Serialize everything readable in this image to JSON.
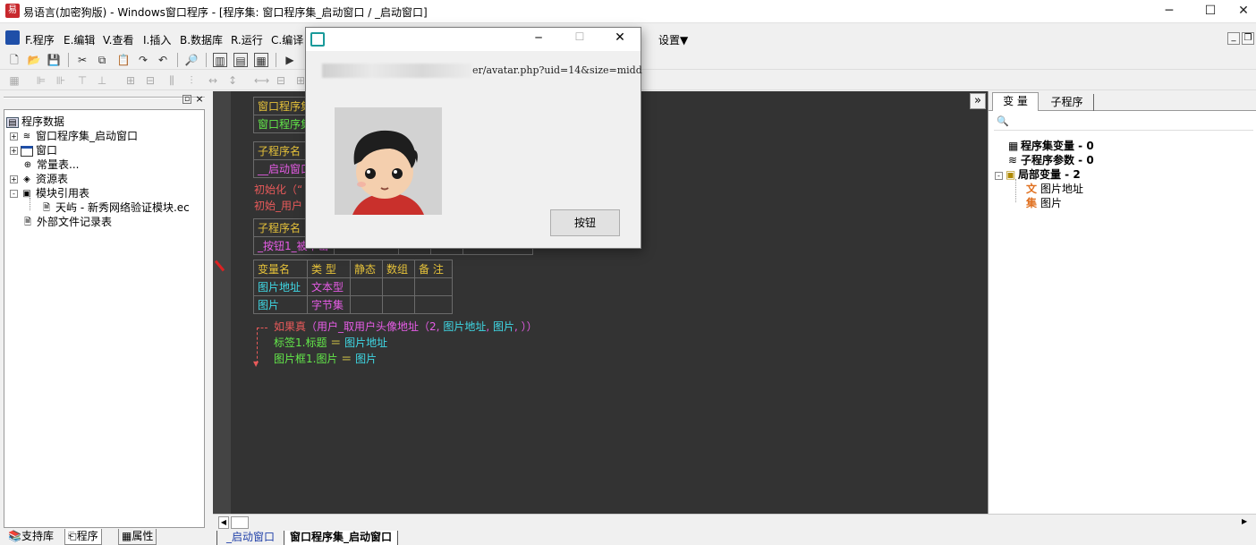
{
  "window": {
    "title": "易语言(加密狗版) - Windows窗口程序 - [程序集: 窗口程序集_启动窗口 / _启动窗口]",
    "min": "─",
    "max": "☐",
    "close": "✕",
    "inner_min": "_",
    "inner_restore": "❐"
  },
  "menu": [
    "F.程序",
    "E.编辑",
    "V.查看",
    "I.插入",
    "B.数据库",
    "R.运行",
    "C.编译"
  ],
  "menu_settings": "设置▼",
  "left_panel": {
    "header_btns": [
      "▫",
      "×"
    ],
    "tree": [
      {
        "label": "程序数据",
        "icon": "db-icon"
      },
      {
        "label": "窗口程序集_启动窗口",
        "icon": "module-icon",
        "toggle": "+"
      },
      {
        "label": "窗口",
        "icon": "window-icon",
        "toggle": "+"
      },
      {
        "label": "常量表...",
        "icon": "constant-icon"
      },
      {
        "label": "资源表",
        "icon": "resource-icon",
        "toggle": "+"
      },
      {
        "label": "模块引用表",
        "icon": "module-ref-icon",
        "toggle": "-"
      },
      {
        "label": "天屿 - 新秀网络验证模块.ec",
        "icon": "file-icon"
      },
      {
        "label": "外部文件记录表",
        "icon": "file-icon"
      }
    ],
    "tabs": [
      "支持库",
      "程序",
      "属性"
    ]
  },
  "editor": {
    "table1": {
      "header": "窗口程序集",
      "row": "窗口程序集"
    },
    "table2": {
      "header": "子程序名",
      "row": "__启动窗口"
    },
    "line_init1": "初始化（“",
    "line_init2": "初始_用户",
    "table3": {
      "header": "子程序名",
      "row": "_按钮1_被单击"
    },
    "vars": {
      "headers": [
        "变量名",
        "类 型",
        "静态",
        "数组",
        "备 注"
      ],
      "rows": [
        [
          "图片地址",
          "文本型",
          "",
          "",
          ""
        ],
        [
          "图片",
          "字节集",
          "",
          "",
          ""
        ]
      ]
    },
    "code": {
      "if_kw": "如果真",
      "if_open": "（",
      "if_func": "用户_取用户头像地址",
      "if_args_a": "（2, ",
      "if_args_b": "图片地址",
      "if_args_c": ", ",
      "if_args_d": "图片",
      "if_args_e": ", ））",
      "line2_a": "标签1.标题",
      "line2_b": " ＝ ",
      "line2_c": "图片地址",
      "line3_a": "图片框1.图片",
      "line3_b": " ＝ ",
      "line3_c": "图片"
    },
    "bottom_tabs": [
      "_启动窗口",
      "窗口程序集_启动窗口"
    ]
  },
  "right_panel": {
    "collapse": "»",
    "tabs": [
      "变 量",
      "子程序"
    ],
    "search_icon": "🔍",
    "items": [
      {
        "label": "程序集变量 - 0",
        "bold": true
      },
      {
        "label": "子程序参数 - 0",
        "bold": true
      },
      {
        "label": "局部变量 - 2",
        "bold": true
      },
      {
        "prefix": "文",
        "label": "图片地址"
      },
      {
        "prefix": "集",
        "label": "图片"
      }
    ]
  },
  "dialog": {
    "min": "─",
    "max": "☐",
    "close": "✕",
    "url": "er/avatar.php?uid=14&size=midd",
    "button": "按钮"
  }
}
